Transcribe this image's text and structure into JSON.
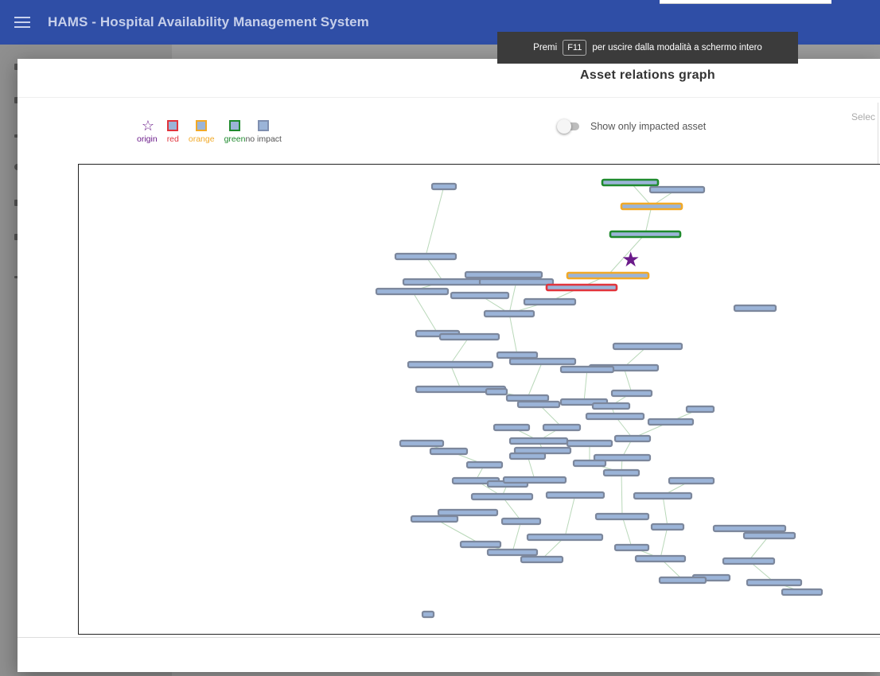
{
  "app": {
    "title": "HAMS - Hospital Availability Management System"
  },
  "fullscreen_toast": {
    "prefix": "Premi",
    "key": "F11",
    "suffix": "per uscire dalla modalità a schermo intero"
  },
  "dialog": {
    "title": "Asset relations graph",
    "legend": [
      {
        "label": "origin",
        "symbol": "star",
        "color": "#6b1b8a",
        "fill": "none"
      },
      {
        "label": "red",
        "symbol": "square",
        "color": "#e1343c",
        "fill": "#9bb4d8"
      },
      {
        "label": "orange",
        "symbol": "square",
        "color": "#f1a928",
        "fill": "#9bb4d8"
      },
      {
        "label": "green",
        "symbol": "square",
        "color": "#1f8a2e",
        "fill": "#9bb4d8"
      },
      {
        "label": "no impact",
        "symbol": "square",
        "color": "#7f8fb0",
        "fill": "#9bb4d8"
      }
    ],
    "toggle_label": "Show only impacted asset",
    "toggle_on": false,
    "select_label": "Selec"
  }
}
